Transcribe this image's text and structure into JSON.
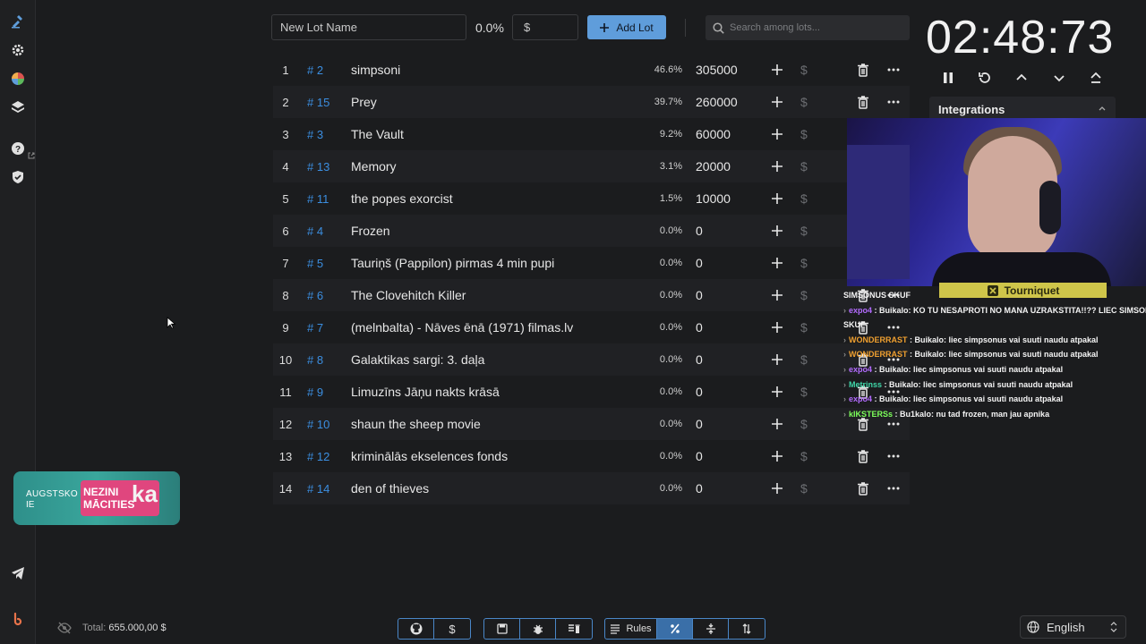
{
  "toolbar": {
    "lot_name_placeholder": "New Lot Name",
    "percent_label": "0.0%",
    "amount_placeholder": "$",
    "add_lot_label": "Add Lot",
    "search_placeholder": "Search among lots..."
  },
  "lots": [
    {
      "index": "1",
      "id": "# 2",
      "name": "simpsoni",
      "percent": "46.6%",
      "amount": "305000"
    },
    {
      "index": "2",
      "id": "# 15",
      "name": "Prey",
      "percent": "39.7%",
      "amount": "260000"
    },
    {
      "index": "3",
      "id": "# 3",
      "name": "The Vault",
      "percent": "9.2%",
      "amount": "60000"
    },
    {
      "index": "4",
      "id": "# 13",
      "name": "Memory",
      "percent": "3.1%",
      "amount": "20000"
    },
    {
      "index": "5",
      "id": "# 11",
      "name": "the popes exorcist",
      "percent": "1.5%",
      "amount": "10000"
    },
    {
      "index": "6",
      "id": "# 4",
      "name": "Frozen",
      "percent": "0.0%",
      "amount": "0"
    },
    {
      "index": "7",
      "id": "# 5",
      "name": "Tauriņš (Pappilon) pirmas 4 min pupi",
      "percent": "0.0%",
      "amount": "0"
    },
    {
      "index": "8",
      "id": "# 6",
      "name": "The Clovehitch Killer",
      "percent": "0.0%",
      "amount": "0"
    },
    {
      "index": "9",
      "id": "# 7",
      "name": "(melnbalta) - Nāves ēnā (1971) filmas.lv",
      "percent": "0.0%",
      "amount": "0"
    },
    {
      "index": "10",
      "id": "# 8",
      "name": "Galaktikas sargi: 3. daļa",
      "percent": "0.0%",
      "amount": "0"
    },
    {
      "index": "11",
      "id": "# 9",
      "name": "Limuzīns Jāņu nakts krāsā",
      "percent": "0.0%",
      "amount": "0"
    },
    {
      "index": "12",
      "id": "# 10",
      "name": "shaun the sheep movie",
      "percent": "0.0%",
      "amount": "0"
    },
    {
      "index": "13",
      "id": "# 12",
      "name": "kriminālās ekselences fonds",
      "percent": "0.0%",
      "amount": "0"
    },
    {
      "index": "14",
      "id": "# 14",
      "name": "den of thieves",
      "percent": "0.0%",
      "amount": "0"
    }
  ],
  "lot_dollar_glyph": "$",
  "timer": {
    "display": "02:48:73"
  },
  "integrations": {
    "title": "Integrations"
  },
  "overlay": {
    "yellow_button": "Tourniquet",
    "chat": [
      {
        "user": "",
        "color": "#ffffff",
        "text": "SIMSONUS SKUF"
      },
      {
        "user": "expo4",
        "color": "#b36bff",
        "text": ": Buikalo: KO TU NESAPROTI NO MANA UZRAKSTITA!!?? LIEC SIMSONUS"
      },
      {
        "user": "",
        "color": "#ffffff",
        "text": "SKUF"
      },
      {
        "user": "WONDERRAST",
        "color": "#f0a030",
        "text": ": Buikalo: liec simpsonus vai suuti naudu atpakal"
      },
      {
        "user": "WONDERRAST",
        "color": "#f0a030",
        "text": ": Buikalo: liec simpsonus vai suuti naudu atpakal"
      },
      {
        "user": "expo4",
        "color": "#b36bff",
        "text": ": Buikalo: liec simpsonus vai suuti naudu atpakal"
      },
      {
        "user": "Metrinss",
        "color": "#3fd6a8",
        "text": ": Buikalo: liec simpsonus vai suuti naudu atpakal"
      },
      {
        "user": "expo4",
        "color": "#b36bff",
        "text": ": Buikalo: liec simpsonus vai suuti naudu atpakal"
      },
      {
        "user": "kIKSTERSs",
        "color": "#7cff5a",
        "text": ": Bu1kalo: nu tad frozen, man jau apnika"
      }
    ]
  },
  "promo": {
    "line1": "AUGSTSKO",
    "line2": "IE",
    "line3a": "NEZINI",
    "line3b": "MĀCITIES",
    "big": "ka"
  },
  "footer": {
    "total_label": "Total:",
    "total_value": "655.000,00 $",
    "rules_label": "Rules",
    "dollar_glyph": "$",
    "language": "English"
  },
  "colors": {
    "accent": "#5f9ddb",
    "id_blue": "#3b8ee0",
    "background": "#1b1c1e"
  }
}
